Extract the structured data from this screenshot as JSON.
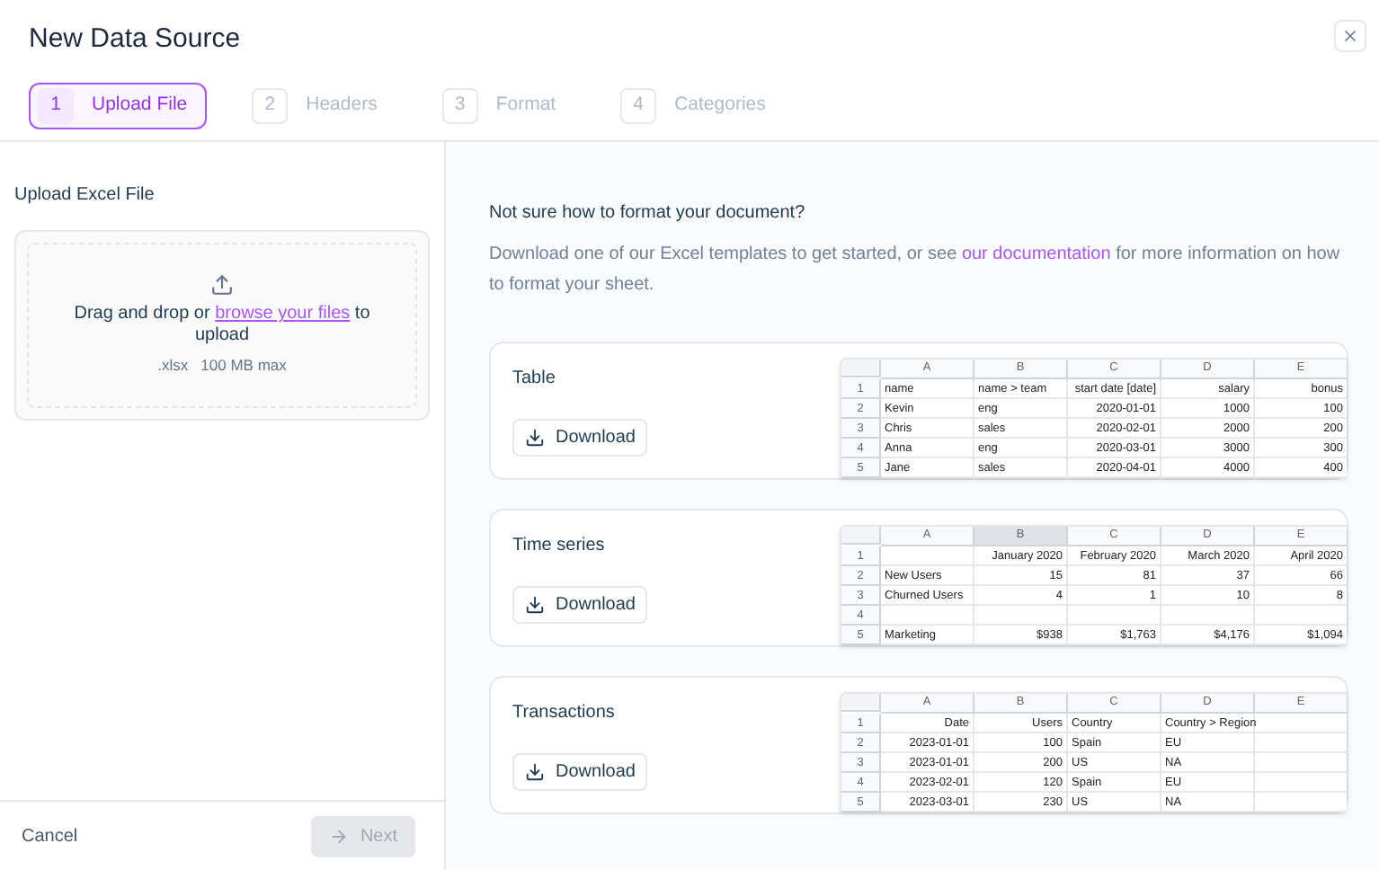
{
  "title": "New Data Source",
  "steps": [
    {
      "number": "1",
      "label": "Upload File",
      "selected": true
    },
    {
      "number": "2",
      "label": "Headers",
      "selected": false
    },
    {
      "number": "3",
      "label": "Format",
      "selected": false
    },
    {
      "number": "4",
      "label": "Categories",
      "selected": false
    }
  ],
  "upload": {
    "heading": "Upload Excel File",
    "text_before": "Drag and drop or",
    "link": "browse your files",
    "text_after": "to upload",
    "hint": ".xlsx   100 MB max"
  },
  "footer": {
    "cancel": "Cancel",
    "next": "Next",
    "next_disabled": true
  },
  "help": {
    "heading": "Not sure how to format your document?",
    "text_before": "Download one of our Excel templates to get started, or see",
    "link": "our documentation",
    "text_after": "for more information on how to format your sheet."
  },
  "templates": [
    {
      "name": "Table",
      "button": "Download",
      "preview": {
        "columns": [
          {
            "letter": "A",
            "kind": "text",
            "selected": false
          },
          {
            "letter": "B",
            "kind": "text",
            "selected": false
          },
          {
            "letter": "C",
            "kind": "number",
            "selected": false
          },
          {
            "letter": "D",
            "kind": "number",
            "selected": false
          },
          {
            "letter": "E",
            "kind": "number",
            "selected": false
          }
        ],
        "rows": [
          {
            "number": "1",
            "cells": [
              "name",
              "name > team",
              "start date [date]",
              "salary",
              "bonus"
            ]
          },
          {
            "number": "2",
            "cells": [
              "Kevin",
              "eng",
              "2020-01-01",
              "1000",
              "100"
            ]
          },
          {
            "number": "3",
            "cells": [
              "Chris",
              "sales",
              "2020-02-01",
              "2000",
              "200"
            ]
          },
          {
            "number": "4",
            "cells": [
              "Anna",
              "eng",
              "2020-03-01",
              "3000",
              "300"
            ]
          },
          {
            "number": "5",
            "cells": [
              "Jane",
              "sales",
              "2020-04-01",
              "4000",
              "400"
            ]
          }
        ]
      }
    },
    {
      "name": "Time series",
      "button": "Download",
      "preview": {
        "columns": [
          {
            "letter": "A",
            "kind": "text",
            "selected": false
          },
          {
            "letter": "B",
            "kind": "number",
            "selected": true
          },
          {
            "letter": "C",
            "kind": "number",
            "selected": false
          },
          {
            "letter": "D",
            "kind": "number",
            "selected": false
          },
          {
            "letter": "E",
            "kind": "number",
            "selected": false
          }
        ],
        "rows": [
          {
            "number": "1",
            "cells": [
              null,
              "January 2020",
              "February 2020",
              "March 2020",
              "April 2020"
            ]
          },
          {
            "number": "2",
            "cells": [
              "New Users",
              "15",
              "81",
              "37",
              "66"
            ]
          },
          {
            "number": "3",
            "cells": [
              "Churned Users",
              "4",
              "1",
              "10",
              "8"
            ]
          },
          {
            "number": "4",
            "cells": [
              null,
              null,
              null,
              null,
              null
            ]
          },
          {
            "number": "5",
            "cells": [
              "Marketing",
              "$938",
              "$1,763",
              "$4,176",
              "$1,094"
            ]
          }
        ]
      }
    },
    {
      "name": "Transactions",
      "button": "Download",
      "preview": {
        "columns": [
          {
            "letter": "A",
            "kind": "number",
            "selected": false
          },
          {
            "letter": "B",
            "kind": "number",
            "selected": false
          },
          {
            "letter": "C",
            "kind": "text",
            "selected": false
          },
          {
            "letter": "D",
            "kind": "text",
            "selected": false
          },
          {
            "letter": "E",
            "kind": "text",
            "selected": false
          }
        ],
        "rows": [
          {
            "number": "1",
            "cells": [
              "Date",
              "Users",
              "Country",
              "Country > Region",
              null
            ]
          },
          {
            "number": "2",
            "cells": [
              "2023-01-01",
              "100",
              "Spain",
              "EU",
              null
            ]
          },
          {
            "number": "3",
            "cells": [
              "2023-01-01",
              "200",
              "US",
              "NA",
              null
            ]
          },
          {
            "number": "4",
            "cells": [
              "2023-02-01",
              "120",
              "Spain",
              "EU",
              null
            ]
          },
          {
            "number": "5",
            "cells": [
              "2023-03-01",
              "230",
              "US",
              "NA",
              null
            ]
          }
        ]
      }
    }
  ]
}
